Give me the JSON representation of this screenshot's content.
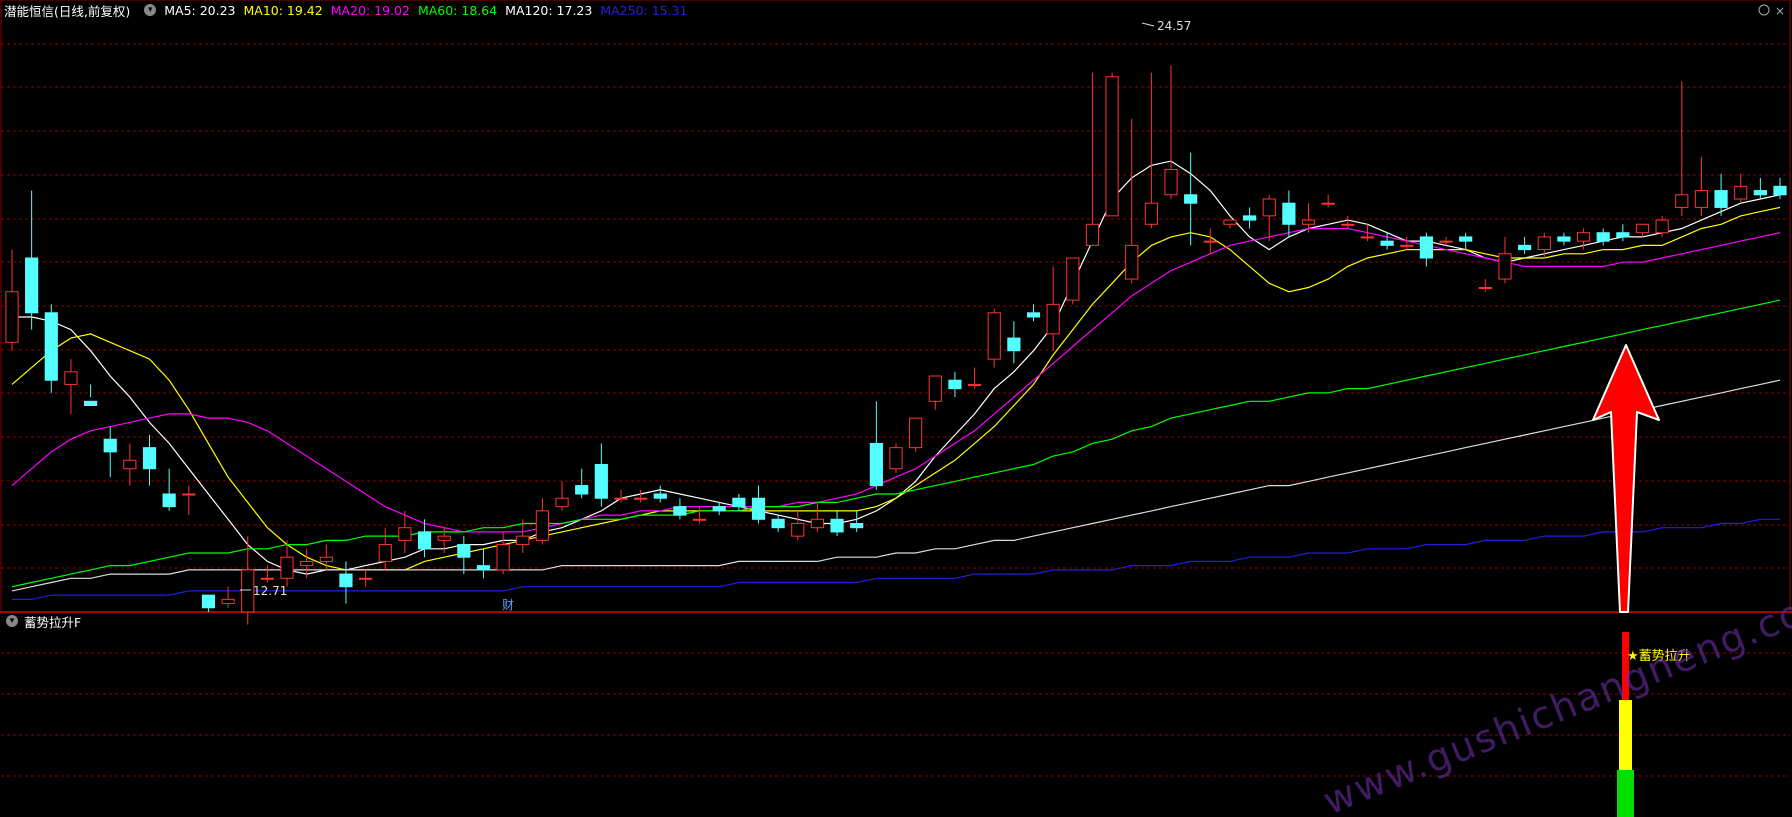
{
  "header": {
    "stock_title": "潜能恒信(日线,前复权)",
    "indicators": [
      {
        "label": "MA5: 20.23",
        "color": "#ffffff"
      },
      {
        "label": "MA10: 19.42",
        "color": "#ffff00"
      },
      {
        "label": "MA20: 19.02",
        "color": "#ff00ff"
      },
      {
        "label": "MA60: 18.64",
        "color": "#00ff00"
      },
      {
        "label": "MA120: 17.23",
        "color": "#ffffff"
      },
      {
        "label": "MA250: 15.31",
        "color": "#1e1ecc"
      }
    ]
  },
  "sub_panel": {
    "title": "蓄势拉升F",
    "signal_label": "★蓄势拉升",
    "signal_colors": [
      "#ff0000",
      "#ffff00",
      "#00dd00"
    ]
  },
  "annotations": {
    "high_label": "24.57",
    "low_label": "12.71",
    "finance_marker": "财",
    "watermark": "www.gushichangneng.com"
  },
  "colors": {
    "up": "#ff3333",
    "down": "#54ffff",
    "grid": "#8b0000",
    "arrow": "#ff0000"
  },
  "chart_data": {
    "type": "candlestick",
    "x_count": 91,
    "price_scale": {
      "top": 25.6,
      "bottom": 11.6
    },
    "candles": [
      [
        18.0,
        19.2,
        17.8,
        20.2
      ],
      [
        20.0,
        18.7,
        18.3,
        21.6
      ],
      [
        18.7,
        17.1,
        16.8,
        18.9
      ],
      [
        17.0,
        17.3,
        16.3,
        17.6
      ],
      [
        16.6,
        16.5,
        16.7,
        17.0
      ],
      [
        15.7,
        15.4,
        14.8,
        16.0
      ],
      [
        15.0,
        15.2,
        14.6,
        15.6
      ],
      [
        15.5,
        15.0,
        14.6,
        15.8
      ],
      [
        14.4,
        14.1,
        14.0,
        15.0
      ],
      [
        14.4,
        14.4,
        13.9,
        14.6
      ],
      [
        12.0,
        11.7,
        11.6,
        11.9
      ],
      [
        11.8,
        11.9,
        11.7,
        12.2
      ],
      [
        11.6,
        12.6,
        11.3,
        13.4
      ],
      [
        12.4,
        12.4,
        12.3,
        12.7
      ],
      [
        12.4,
        12.9,
        12.2,
        13.3
      ],
      [
        12.7,
        12.8,
        12.4,
        13.1
      ],
      [
        12.8,
        12.9,
        12.6,
        13.2
      ],
      [
        12.5,
        12.2,
        11.8,
        12.8
      ],
      [
        12.4,
        12.4,
        12.2,
        12.6
      ],
      [
        12.8,
        13.2,
        12.6,
        13.6
      ],
      [
        13.3,
        13.6,
        13.0,
        14.0
      ],
      [
        13.5,
        13.1,
        12.9,
        13.8
      ],
      [
        13.3,
        13.4,
        13.0,
        13.6
      ],
      [
        13.2,
        12.9,
        12.5,
        13.4
      ],
      [
        12.7,
        12.6,
        12.4,
        13.1
      ],
      [
        12.6,
        13.2,
        12.5,
        13.5
      ],
      [
        13.2,
        13.4,
        13.0,
        13.8
      ],
      [
        13.3,
        14.0,
        13.2,
        14.3
      ],
      [
        14.1,
        14.3,
        14.0,
        14.7
      ],
      [
        14.6,
        14.4,
        14.3,
        15.0
      ],
      [
        15.1,
        14.3,
        14.1,
        15.6
      ],
      [
        14.3,
        14.3,
        14.2,
        14.5
      ],
      [
        14.3,
        14.3,
        14.2,
        14.5
      ],
      [
        14.4,
        14.3,
        14.2,
        14.6
      ],
      [
        14.1,
        13.9,
        13.8,
        14.3
      ],
      [
        13.8,
        13.8,
        13.7,
        14.1
      ],
      [
        14.1,
        14.0,
        13.9,
        14.2
      ],
      [
        14.3,
        14.1,
        14.0,
        14.4
      ],
      [
        14.3,
        13.8,
        13.7,
        14.6
      ],
      [
        13.8,
        13.6,
        13.5,
        13.9
      ],
      [
        13.4,
        13.7,
        13.3,
        14.0
      ],
      [
        13.6,
        13.8,
        13.5,
        14.2
      ],
      [
        13.8,
        13.5,
        13.4,
        14.0
      ],
      [
        13.7,
        13.6,
        13.5,
        14.0
      ],
      [
        15.6,
        14.6,
        14.5,
        16.6
      ],
      [
        15.0,
        15.5,
        14.9,
        15.6
      ],
      [
        15.5,
        16.2,
        15.4,
        16.2
      ],
      [
        16.6,
        17.2,
        16.4,
        17.2
      ],
      [
        17.1,
        16.9,
        16.7,
        17.3
      ],
      [
        17.0,
        17.0,
        16.9,
        17.4
      ],
      [
        17.6,
        18.7,
        17.4,
        18.8
      ],
      [
        18.1,
        17.8,
        17.5,
        18.5
      ],
      [
        18.7,
        18.6,
        18.5,
        18.9
      ],
      [
        18.2,
        18.9,
        17.8,
        19.8
      ],
      [
        19.0,
        20.0,
        18.9,
        20.0
      ],
      [
        20.3,
        20.8,
        20.3,
        24.4
      ],
      [
        21.0,
        24.3,
        21.0,
        24.4
      ],
      [
        19.5,
        20.3,
        19.4,
        23.3
      ],
      [
        20.8,
        21.3,
        20.7,
        24.4
      ],
      [
        21.5,
        22.1,
        21.4,
        24.57
      ],
      [
        21.5,
        21.3,
        20.3,
        22.5
      ],
      [
        20.4,
        20.4,
        20.1,
        20.7
      ],
      [
        20.8,
        20.9,
        20.7,
        20.9
      ],
      [
        21.0,
        20.9,
        20.7,
        21.2
      ],
      [
        21.0,
        21.4,
        20.4,
        21.5
      ],
      [
        21.3,
        20.8,
        20.5,
        21.6
      ],
      [
        20.8,
        20.9,
        20.6,
        21.3
      ],
      [
        21.3,
        21.3,
        21.2,
        21.5
      ],
      [
        20.8,
        20.8,
        20.7,
        21.0
      ],
      [
        20.5,
        20.5,
        20.4,
        20.8
      ],
      [
        20.4,
        20.3,
        20.2,
        20.6
      ],
      [
        20.3,
        20.3,
        20.2,
        20.5
      ],
      [
        20.5,
        20.0,
        19.8,
        20.6
      ],
      [
        20.4,
        20.4,
        20.3,
        20.5
      ],
      [
        20.5,
        20.4,
        20.2,
        20.6
      ],
      [
        19.3,
        19.3,
        19.2,
        19.5
      ],
      [
        19.5,
        20.1,
        19.4,
        20.5
      ],
      [
        20.3,
        20.2,
        20.1,
        20.5
      ],
      [
        20.2,
        20.5,
        20.0,
        20.6
      ],
      [
        20.5,
        20.4,
        20.3,
        20.6
      ],
      [
        20.4,
        20.6,
        20.2,
        20.7
      ],
      [
        20.6,
        20.4,
        20.3,
        20.7
      ],
      [
        20.6,
        20.5,
        20.4,
        20.8
      ],
      [
        20.6,
        20.8,
        20.5,
        20.8
      ],
      [
        20.6,
        20.9,
        20.5,
        21.0
      ],
      [
        21.2,
        21.5,
        21.0,
        24.2
      ],
      [
        21.2,
        21.6,
        21.0,
        22.4
      ],
      [
        21.6,
        21.2,
        21.0,
        22.0
      ],
      [
        21.4,
        21.7,
        21.3,
        22.0
      ],
      [
        21.6,
        21.5,
        21.4,
        21.9
      ],
      [
        21.7,
        21.5,
        21.4,
        21.9
      ]
    ],
    "ma_series": [
      {
        "name": "MA5",
        "color": "#ffffff",
        "values": [
          18.6,
          18.6,
          18.5,
          18.3,
          17.8,
          17.2,
          16.7,
          16.1,
          15.6,
          15.0,
          14.4,
          13.8,
          13.2,
          12.8,
          12.6,
          12.5,
          12.6,
          12.6,
          12.7,
          12.8,
          12.9,
          13.1,
          13.1,
          13.2,
          13.2,
          13.3,
          13.3,
          13.5,
          13.6,
          13.8,
          14.0,
          14.3,
          14.4,
          14.5,
          14.4,
          14.3,
          14.2,
          14.1,
          14.0,
          13.9,
          13.8,
          13.7,
          13.7,
          13.8,
          14.0,
          14.3,
          14.7,
          15.3,
          15.8,
          16.3,
          16.9,
          17.3,
          17.8,
          18.4,
          19.4,
          20.4,
          21.4,
          21.9,
          22.2,
          22.3,
          22.0,
          21.6,
          21.0,
          20.5,
          20.2,
          20.5,
          20.7,
          20.8,
          20.9,
          20.8,
          20.6,
          20.4,
          20.4,
          20.3,
          20.2,
          20.0,
          19.9,
          20.0,
          20.1,
          20.2,
          20.3,
          20.4,
          20.5,
          20.5,
          20.6,
          20.7,
          20.9,
          21.1,
          21.3,
          21.4,
          21.5
        ]
      },
      {
        "name": "MA10",
        "color": "#ffff00",
        "values": [
          17.0,
          17.4,
          17.8,
          18.1,
          18.2,
          18.0,
          17.8,
          17.6,
          17.1,
          16.4,
          15.6,
          14.8,
          14.2,
          13.6,
          13.2,
          12.9,
          12.7,
          12.6,
          12.6,
          12.6,
          12.6,
          12.8,
          12.9,
          13.0,
          13.1,
          13.2,
          13.3,
          13.4,
          13.5,
          13.6,
          13.7,
          13.8,
          13.9,
          14.0,
          14.0,
          14.0,
          14.0,
          14.0,
          14.0,
          14.0,
          14.0,
          14.0,
          14.0,
          14.0,
          14.1,
          14.3,
          14.6,
          14.9,
          15.2,
          15.6,
          16.0,
          16.5,
          17.0,
          17.7,
          18.3,
          18.9,
          19.4,
          19.9,
          20.3,
          20.5,
          20.6,
          20.5,
          20.2,
          19.8,
          19.4,
          19.2,
          19.3,
          19.5,
          19.8,
          20.0,
          20.1,
          20.2,
          20.2,
          20.2,
          20.2,
          20.1,
          20.0,
          20.0,
          20.0,
          20.1,
          20.1,
          20.2,
          20.2,
          20.3,
          20.3,
          20.5,
          20.7,
          20.8,
          21.0,
          21.1,
          21.2
        ]
      },
      {
        "name": "MA20",
        "color": "#ff00ff",
        "values": [
          14.6,
          15.0,
          15.4,
          15.7,
          15.9,
          16.0,
          16.1,
          16.2,
          16.3,
          16.3,
          16.2,
          16.2,
          16.1,
          15.9,
          15.6,
          15.3,
          15.0,
          14.7,
          14.4,
          14.1,
          13.9,
          13.7,
          13.6,
          13.5,
          13.5,
          13.5,
          13.5,
          13.6,
          13.7,
          13.8,
          13.9,
          13.9,
          14.0,
          14.0,
          14.1,
          14.1,
          14.1,
          14.1,
          14.1,
          14.1,
          14.2,
          14.2,
          14.3,
          14.4,
          14.6,
          14.8,
          15.0,
          15.3,
          15.6,
          15.9,
          16.3,
          16.7,
          17.1,
          17.5,
          17.9,
          18.3,
          18.7,
          19.1,
          19.4,
          19.7,
          19.9,
          20.1,
          20.3,
          20.4,
          20.5,
          20.6,
          20.7,
          20.7,
          20.7,
          20.6,
          20.5,
          20.4,
          20.3,
          20.2,
          20.1,
          20.0,
          19.9,
          19.8,
          19.8,
          19.8,
          19.8,
          19.8,
          19.9,
          19.9,
          20.0,
          20.1,
          20.2,
          20.3,
          20.4,
          20.5,
          20.6
        ]
      },
      {
        "name": "MA60",
        "color": "#00ff00",
        "values": [
          12.2,
          12.3,
          12.4,
          12.5,
          12.6,
          12.7,
          12.7,
          12.8,
          12.9,
          13.0,
          13.0,
          13.0,
          13.1,
          13.1,
          13.2,
          13.2,
          13.3,
          13.3,
          13.4,
          13.4,
          13.4,
          13.5,
          13.5,
          13.5,
          13.6,
          13.6,
          13.7,
          13.7,
          13.7,
          13.8,
          13.8,
          13.8,
          13.9,
          13.9,
          13.9,
          14.0,
          14.0,
          14.0,
          14.1,
          14.1,
          14.1,
          14.2,
          14.2,
          14.3,
          14.4,
          14.4,
          14.5,
          14.6,
          14.7,
          14.8,
          14.9,
          15.0,
          15.1,
          15.3,
          15.4,
          15.6,
          15.7,
          15.9,
          16.0,
          16.2,
          16.3,
          16.4,
          16.5,
          16.6,
          16.6,
          16.7,
          16.8,
          16.8,
          16.9,
          16.9,
          17.0,
          17.1,
          17.2,
          17.3,
          17.4,
          17.5,
          17.6,
          17.7,
          17.8,
          17.9,
          18.0,
          18.1,
          18.2,
          18.3,
          18.4,
          18.5,
          18.6,
          18.7,
          18.8,
          18.9,
          19.0
        ]
      },
      {
        "name": "MA120",
        "color": "#dddddd",
        "values": [
          12.1,
          12.2,
          12.3,
          12.4,
          12.4,
          12.5,
          12.5,
          12.5,
          12.5,
          12.6,
          12.6,
          12.6,
          12.6,
          12.6,
          12.6,
          12.6,
          12.6,
          12.6,
          12.6,
          12.6,
          12.6,
          12.6,
          12.6,
          12.6,
          12.6,
          12.6,
          12.6,
          12.6,
          12.7,
          12.7,
          12.7,
          12.7,
          12.7,
          12.7,
          12.7,
          12.7,
          12.7,
          12.8,
          12.8,
          12.8,
          12.8,
          12.8,
          12.9,
          12.9,
          12.9,
          13.0,
          13.0,
          13.1,
          13.1,
          13.2,
          13.3,
          13.3,
          13.4,
          13.5,
          13.6,
          13.7,
          13.8,
          13.9,
          14.0,
          14.1,
          14.2,
          14.3,
          14.4,
          14.5,
          14.6,
          14.6,
          14.7,
          14.8,
          14.9,
          15.0,
          15.1,
          15.2,
          15.3,
          15.4,
          15.5,
          15.6,
          15.7,
          15.8,
          15.9,
          16.0,
          16.1,
          16.2,
          16.3,
          16.4,
          16.5,
          16.6,
          16.7,
          16.8,
          16.9,
          17.0,
          17.1
        ]
      },
      {
        "name": "MA250",
        "color": "#2020dd",
        "values": [
          11.9,
          11.9,
          12.0,
          12.0,
          12.0,
          12.0,
          12.0,
          12.0,
          12.0,
          12.1,
          12.1,
          12.1,
          12.1,
          12.1,
          12.1,
          12.1,
          12.1,
          12.1,
          12.1,
          12.1,
          12.1,
          12.1,
          12.1,
          12.1,
          12.1,
          12.1,
          12.2,
          12.2,
          12.2,
          12.2,
          12.2,
          12.2,
          12.2,
          12.2,
          12.2,
          12.2,
          12.2,
          12.3,
          12.3,
          12.3,
          12.3,
          12.3,
          12.3,
          12.3,
          12.4,
          12.4,
          12.4,
          12.4,
          12.4,
          12.5,
          12.5,
          12.5,
          12.5,
          12.6,
          12.6,
          12.6,
          12.6,
          12.7,
          12.7,
          12.7,
          12.8,
          12.8,
          12.8,
          12.9,
          12.9,
          12.9,
          13.0,
          13.0,
          13.0,
          13.1,
          13.1,
          13.1,
          13.2,
          13.2,
          13.2,
          13.3,
          13.3,
          13.3,
          13.4,
          13.4,
          13.4,
          13.5,
          13.5,
          13.5,
          13.6,
          13.6,
          13.6,
          13.7,
          13.7,
          13.8,
          13.8
        ]
      }
    ]
  }
}
